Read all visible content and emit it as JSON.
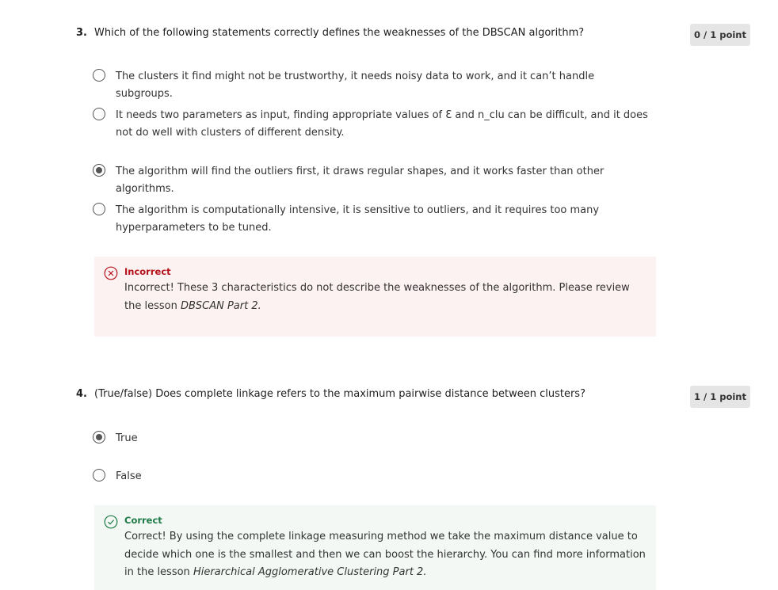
{
  "colors": {
    "incorrect_bg": "#fdf2f2",
    "incorrect_text": "#b3111a",
    "correct_bg": "#f3f8f5",
    "correct_text": "#1d7a47",
    "points_badge_bg": "#e5e5e5"
  },
  "questions": [
    {
      "number": "3.",
      "text": "Which of the following statements correctly defines the weaknesses of the DBSCAN algorithm?",
      "points": "0 / 1 point",
      "options": [
        {
          "label": "The clusters it find might not be trustworthy, it needs noisy data to work, and it can’t handle subgroups.",
          "selected": false
        },
        {
          "label": "It needs two parameters as input, finding appropriate values of Ɛ and n_clu can be difficult, and it does not do well with clusters of different density.",
          "selected": false
        },
        {
          "label": "The algorithm will find the outliers first, it draws regular shapes, and it works faster than other algorithms.",
          "selected": true
        },
        {
          "label": "The algorithm is computationally intensive, it is sensitive to outliers, and it requires too many hyperparameters to be tuned.",
          "selected": false
        }
      ],
      "feedback": {
        "status": "Incorrect",
        "icon": "x-circle-icon",
        "text": "Incorrect! These 3 characteristics do not describe the weaknesses of the algorithm. Please review the lesson ",
        "lesson": "DBSCAN Part 2."
      }
    },
    {
      "number": "4.",
      "text": "(True/false) Does complete linkage refers to the maximum pairwise distance between clusters?",
      "points": "1 / 1 point",
      "options": [
        {
          "label": "True",
          "selected": true
        },
        {
          "label": "False",
          "selected": false
        }
      ],
      "feedback": {
        "status": "Correct",
        "icon": "check-circle-icon",
        "text": "Correct! By using the complete linkage measuring method we take the maximum distance value to decide which one is the smallest and then we can boost the hierarchy. You can find more information in the lesson ",
        "lesson": "Hierarchical Agglomerative Clustering Part 2."
      }
    }
  ]
}
